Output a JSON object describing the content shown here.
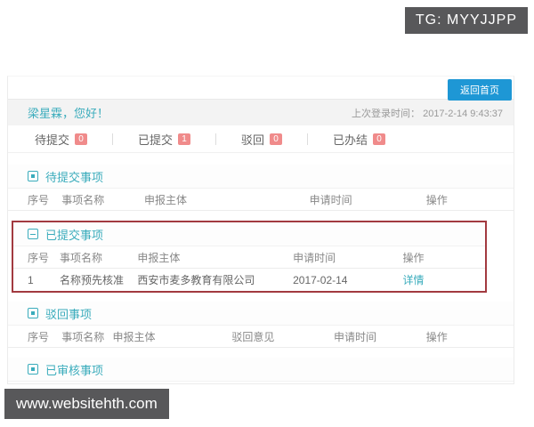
{
  "watermarks": {
    "top": "TG: MYYJJPP",
    "bottom": "www.websitehth.com"
  },
  "header": {
    "back_button": "返回首页",
    "greeting": "梁星霖，您好！",
    "last_login_label": "上次登录时间：",
    "last_login_value": "2017-2-14 9:43:37"
  },
  "tabs": [
    {
      "label": "待提交",
      "count": "0"
    },
    {
      "label": "已提交",
      "count": "1"
    },
    {
      "label": "驳回",
      "count": "0"
    },
    {
      "label": "已办结",
      "count": "0"
    }
  ],
  "sections": [
    {
      "title": "待提交事项",
      "icon": "square-list-icon",
      "icon_style": "square",
      "highlighted": false,
      "columns": [
        "序号",
        "事项名称",
        "申报主体",
        "申请时间",
        "操作"
      ],
      "rows": []
    },
    {
      "title": "已提交事项",
      "icon": "calendar-list-icon",
      "icon_style": "list",
      "highlighted": true,
      "columns": [
        "序号",
        "事项名称",
        "申报主体",
        "申请时间",
        "操作"
      ],
      "rows": [
        {
          "cells": [
            "1",
            "名称预先核准",
            "西安市麦多教育有限公司",
            "2017-02-14"
          ],
          "action": "详情"
        }
      ]
    },
    {
      "title": "驳回事项",
      "icon": "square-list-icon",
      "icon_style": "square",
      "highlighted": false,
      "columns": [
        "序号",
        "事项名称",
        "申报主体",
        "驳回意见",
        "申请时间",
        "操作"
      ],
      "rows": []
    },
    {
      "title": "已审核事项",
      "icon": "square-list-icon",
      "icon_style": "square",
      "highlighted": false,
      "columns": [],
      "rows": []
    }
  ],
  "colors": {
    "accent_teal": "#3aacbc",
    "button_blue": "#1e97d5",
    "badge_pink": "#f08b8b",
    "highlight_red": "#a23a40",
    "watermark_bg": "#58585a"
  }
}
